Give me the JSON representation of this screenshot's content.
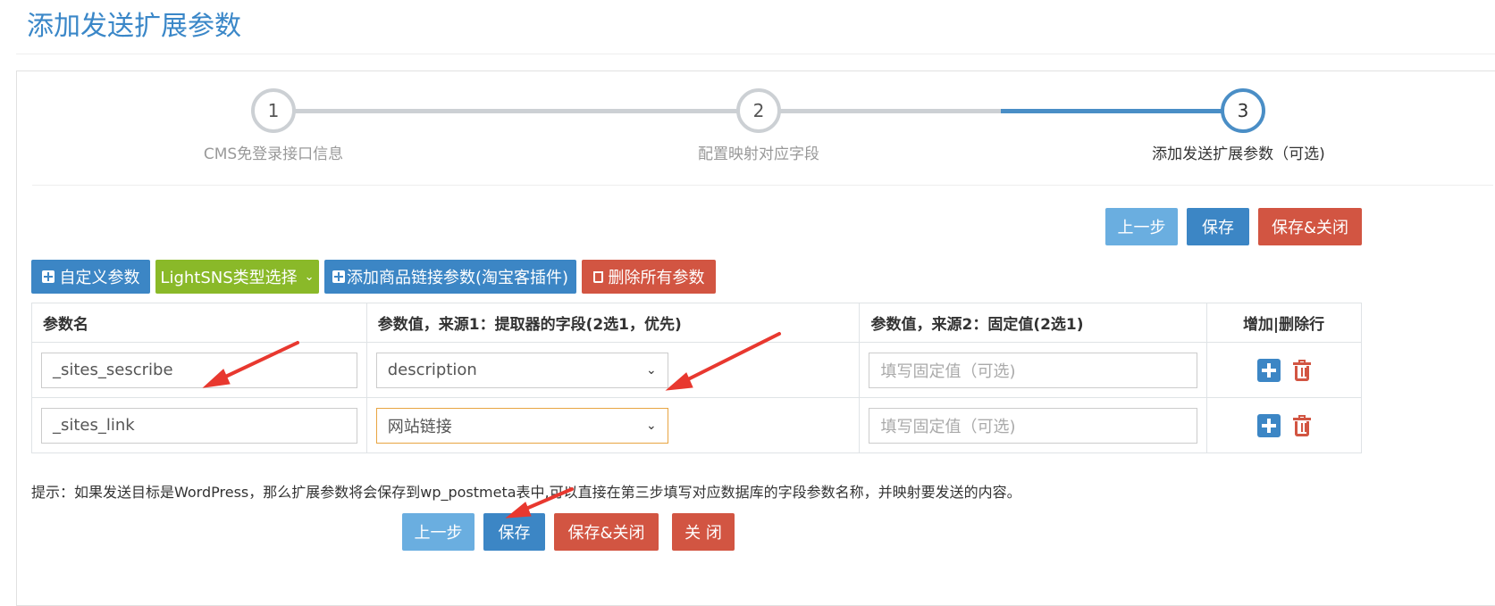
{
  "page": {
    "title": "添加发送扩展参数"
  },
  "steps": [
    {
      "number": "1",
      "label": "CMS免登录接口信息",
      "active": false
    },
    {
      "number": "2",
      "label": "配置映射对应字段",
      "active": false
    },
    {
      "number": "3",
      "label": "添加发送扩展参数（可选)",
      "active": true
    }
  ],
  "top_actions": {
    "prev": "上一步",
    "save": "保存",
    "save_close": "保存&关闭"
  },
  "toolbar": {
    "custom_param": "自定义参数",
    "lightsns_select": "LightSNS类型选择",
    "add_product_link": "添加商品链接参数(淘宝客插件)",
    "delete_all": "删除所有参数"
  },
  "table": {
    "headers": [
      "参数名",
      "参数值，来源1：提取器的字段(2选1，优先)",
      "参数值，来源2：固定值(2选1)",
      "增加|删除行"
    ],
    "rows": [
      {
        "name": "_sites_sescribe",
        "source_field": "description",
        "fixed_placeholder": "填写固定值（可选)"
      },
      {
        "name": "_sites_link",
        "source_field": "网站链接",
        "fixed_placeholder": "填写固定值（可选)"
      }
    ]
  },
  "hint": "提示：如果发送目标是WordPress，那么扩展参数将会保存到wp_postmeta表中,可以直接在第三步填写对应数据库的字段参数名称，并映射要发送的内容。",
  "bottom_actions": {
    "prev": "上一步",
    "save": "保存",
    "save_close": "保存&关闭",
    "close": "关 闭"
  },
  "colors": {
    "primary": "#3c86c5",
    "light": "#6aaee0",
    "danger": "#d25542",
    "success": "#8ab929",
    "annotation": "#e8382f"
  }
}
